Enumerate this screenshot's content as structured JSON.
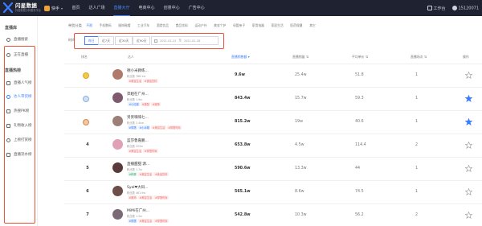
{
  "app": {
    "brand_name": "闪星数据",
    "brand_sub": "抖音数据分析服务平台",
    "platform_label": "快手"
  },
  "nav": [
    "首页",
    "达人广场",
    "直播大厅",
    "电商中心",
    "创意中心",
    "广告中心"
  ],
  "nav_active_index": 2,
  "topbar_right": {
    "workbench": "工作台",
    "user": "15120071"
  },
  "sidebar": {
    "group1_title": "直播库",
    "group1_items": [
      "直播搜索",
      "正在直播"
    ],
    "group2_title": "直播热榜",
    "group2_items": [
      "直播人气榜",
      "达人带货榜",
      "热搜PK榜",
      "礼物收入榜",
      "上榜打赏榜",
      "直播流水榜"
    ],
    "active_item": "达人带货榜"
  },
  "filters": {
    "category_label": "带货分类",
    "categories": [
      "不限",
      "手机数码",
      "服饰鞋帽",
      "工业汽车",
      "酒类饮品",
      "食品饮料",
      "运动户外",
      "美妆个护",
      "母婴亲子",
      "家用电器",
      "家居生活",
      "医药保健",
      "其它"
    ],
    "time_label": "时间",
    "time_buttons": [
      "昨日",
      "近7天",
      "近30天",
      "近90天"
    ],
    "date_start": "2021-02-22",
    "date_sep": "至",
    "date_end": "2021-02-28"
  },
  "table": {
    "headers": {
      "rank": "排名",
      "talent": "达人",
      "sales_volume": "直播销售额",
      "sales_count": "直播销量",
      "avg_price": "平均单价",
      "live_count": "直播场次",
      "action": "操作"
    },
    "sorted_column": "sales_volume",
    "rows": [
      {
        "rank": "1",
        "medal": "gold",
        "name": "德小米教练...",
        "fans": "粉丝数 768.1w",
        "tags": [
          {
            "t": "#美容生活",
            "c": "red"
          },
          {
            "t": "#食品饮料",
            "c": "red"
          }
        ],
        "sales": "9.6w",
        "count": "25.4w",
        "avg": "51.8",
        "lives": "1",
        "fav": false,
        "avatar_color": "#b07a6a"
      },
      {
        "rank": "2",
        "medal": "silver",
        "name": "萍姐在广州...",
        "fans": "粉丝数 1.9w",
        "tags": [
          {
            "t": "#小红服",
            "c": "blue"
          },
          {
            "t": "#搭配",
            "c": "red"
          },
          {
            "t": "#服饰",
            "c": "red"
          }
        ],
        "sales": "843.4w",
        "count": "15.7w",
        "avg": "59.3",
        "lives": "1",
        "fav": true,
        "avatar_color": "#7d5a6e"
      },
      {
        "rank": "3",
        "medal": "bronze",
        "name": "贤贤嗨嗨七...",
        "fans": "粉丝数 2.4kw",
        "tags": [
          {
            "t": "#穿搭",
            "c": "blue"
          },
          {
            "t": "#小冰箱",
            "c": "blue"
          },
          {
            "t": "#美容生活",
            "c": "red"
          },
          {
            "t": "#穿搭时尚",
            "c": "red"
          }
        ],
        "sales": "815.2w",
        "count": "19w",
        "avg": "40.6",
        "lives": "1",
        "fav": true,
        "avatar_color": "#9c7f76"
      },
      {
        "rank": "4",
        "medal": "",
        "name": "蓝莎鲁嘉鹏...",
        "fans": "粉丝数 225w",
        "tags": [
          {
            "t": "#美容生活",
            "c": "red"
          },
          {
            "t": "#穿搭时尚",
            "c": "red"
          }
        ],
        "sales": "653.8w",
        "count": "4.5w",
        "avg": "114.4",
        "lives": "2",
        "fav": false,
        "avatar_color": "#e0a0b5"
      },
      {
        "rank": "5",
        "medal": "",
        "name": "直播甜甜 源...",
        "fans": "粉丝数 1.7w",
        "tags": [
          {
            "t": "#种草",
            "c": "green"
          },
          {
            "t": "#美容生活",
            "c": "red"
          },
          {
            "t": "#食品饮料",
            "c": "red"
          }
        ],
        "sales": "590.6w",
        "count": "13.3w",
        "avg": "44",
        "lives": "1",
        "fav": false,
        "avatar_color": "#5a3a3a"
      },
      {
        "rank": "6",
        "medal": "",
        "name": "Syal❤大码...",
        "fans": "粉丝数 461.9w",
        "tags": [
          {
            "t": "#服饰",
            "c": "red"
          },
          {
            "t": "#美容生活",
            "c": "red"
          },
          {
            "t": "#穿搭时尚",
            "c": "red"
          }
        ],
        "sales": "565.1w",
        "count": "8.6w",
        "avg": "74.5",
        "lives": "1",
        "fav": false,
        "avatar_color": "#6d4f4a"
      },
      {
        "rank": "7",
        "medal": "",
        "name": "MiMi在广州...",
        "fans": "粉丝数 1.2w",
        "tags": [
          {
            "t": "#穿搭",
            "c": "blue"
          },
          {
            "t": "#美容生活",
            "c": "red"
          },
          {
            "t": "#穿搭时尚",
            "c": "red"
          }
        ],
        "sales": "542.8w",
        "count": "10.3w",
        "avg": "56.2",
        "lives": "2",
        "fav": false,
        "avatar_color": "#7a6a76"
      }
    ]
  },
  "colors": {
    "accent": "#3b7cff",
    "highlight_frame": "#e8553b",
    "topbar": "#1f2230"
  }
}
